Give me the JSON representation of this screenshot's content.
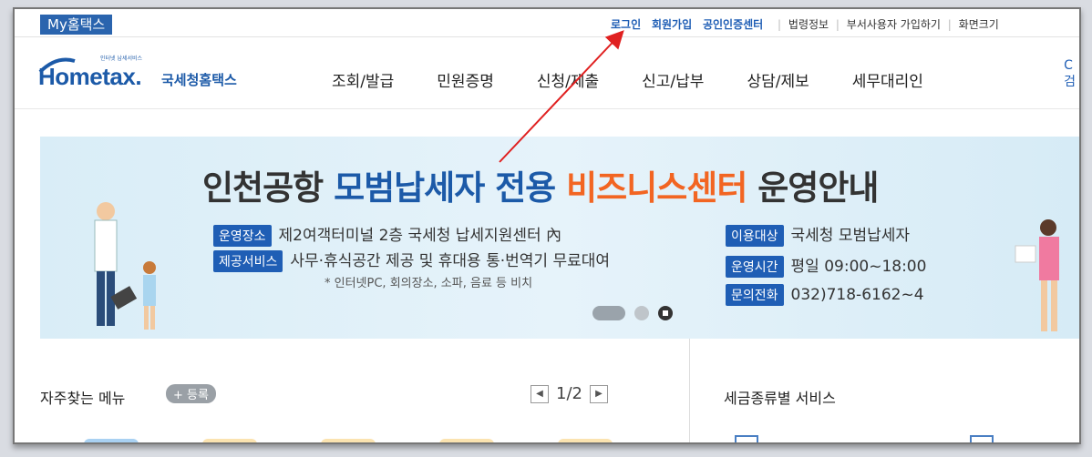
{
  "top": {
    "myhometax": "My홈택스",
    "links_blue": [
      "로그인",
      "회원가입",
      "공인인증센터"
    ],
    "links_gray": [
      "법령정보",
      "부서사용자 가입하기",
      "화면크기"
    ]
  },
  "logo": {
    "small_text": "인터넷 납세서비스",
    "brand": "Hometax.",
    "korean": "국세청홈택스"
  },
  "nav": [
    "조회/발급",
    "민원증명",
    "신청/제출",
    "신고/납부",
    "상담/제보",
    "세무대리인"
  ],
  "edge_text": [
    "C",
    "검"
  ],
  "banner": {
    "headline": {
      "part1": "인천공항",
      "part2": "모범납세자 전용",
      "part3": "비즈니스센터",
      "part4": "운영안내"
    },
    "rows": [
      {
        "tag": "운영장소",
        "text": "제2여객터미널 2층 국세청 납세지원센터 內"
      },
      {
        "tag": "제공서비스",
        "text": "사무·휴식공간 제공 및 휴대용 통·번역기 무료대여"
      },
      {
        "tag": "이용대상",
        "text": "국세청 모범납세자"
      },
      {
        "tag": "운영시간",
        "text": "평일 09:00~18:00"
      },
      {
        "tag": "문의전화",
        "text": "032)718-6162~4"
      }
    ],
    "note": "* 인터넷PC, 회의장소, 소파, 음료 등 비치"
  },
  "favorites": {
    "title": "자주찾는 메뉴",
    "register": "+ 등록",
    "page": "1/2"
  },
  "tax_service": {
    "title": "세금종류별 서비스"
  },
  "colors": {
    "brand_blue": "#1c5aa8",
    "accent_orange": "#f26522",
    "annotation_red": "#e02020"
  }
}
